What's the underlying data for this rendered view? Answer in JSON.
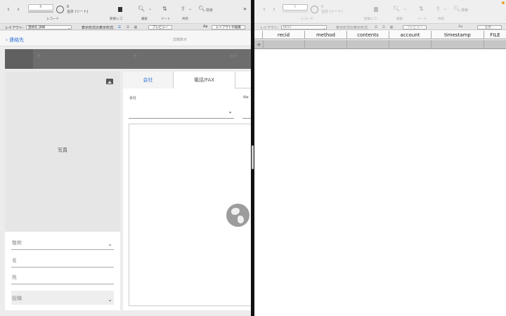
{
  "left": {
    "toolbar": {
      "record_value": "6",
      "total_count": "0",
      "total_label": "合計 (ソート)",
      "record_label": "レコード",
      "new_record_label": "新規レコ",
      "find_label": "検索",
      "sort_label": "ソート",
      "share_label": "共有",
      "search_placeholder": "検索"
    },
    "layout_bar": {
      "layout_label": "レイアウト:",
      "layout_value": "連絡先 詳細",
      "view_as_label": "表示形式の表示形式:",
      "preview_button": "プレビュー",
      "edit_layout_button": "レイアウトの編集",
      "aa": "Aa"
    },
    "header": {
      "back_label": "連絡先",
      "title": "詳細表示"
    },
    "band": {
      "label_a": "姓",
      "label_b": "名",
      "label_c": "会社"
    },
    "photo_label": "写真",
    "fields": {
      "title": "敬称",
      "first": "名",
      "last": "姓",
      "role": "役職"
    },
    "detail": {
      "tab_company": "会社",
      "tab_phone": "電話/FAX",
      "company_label": "会社",
      "website_label": "We"
    }
  },
  "right": {
    "toolbar": {
      "record_value": "0",
      "total_count": "0",
      "total_label": "合計 (ソート)",
      "record_label": "レコード",
      "new_record_label": "新規レコ",
      "find_label": "検索",
      "sort_label": "ソート",
      "share_label": "共有",
      "search_placeholder": "検索"
    },
    "layout_bar": {
      "layout_label": "レイアウト:",
      "layout_value": "REST",
      "view_as_label": "表示形式の表示形式:",
      "preview_button": "プレビュー",
      "edit_layout_button": "変更...",
      "aa": "Aa"
    },
    "table": {
      "columns": [
        "recid",
        "method",
        "contents",
        "account",
        "timestamp",
        "FILE"
      ]
    }
  },
  "colors": {
    "accent": "#2a6fd6",
    "dark_band": "#6d6d6d",
    "selected_row": "#c6c6c6",
    "record_indicator": "#f0a030"
  }
}
